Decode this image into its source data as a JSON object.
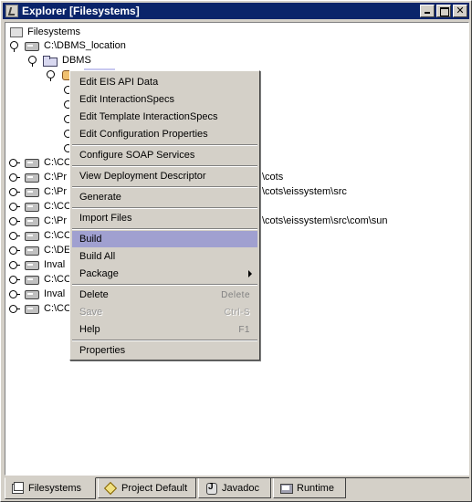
{
  "window": {
    "title": "Explorer [Filesystems]"
  },
  "tree": {
    "root_label": "Filesystems",
    "dbms_location": "C:\\DBMS_location",
    "dbms_folder": "DBMS",
    "fs_rows": [
      {
        "label": "C:\\CO"
      },
      {
        "label": "C:\\Pr",
        "suffix": "\\cots"
      },
      {
        "label": "C:\\Pr",
        "suffix": "\\cots\\eissystem\\src"
      },
      {
        "label": "C:\\CO"
      },
      {
        "label": "C:\\Pr",
        "suffix": "\\cots\\eissystem\\src\\com\\sun"
      },
      {
        "label": "C:\\CO"
      },
      {
        "label": "C:\\DE"
      },
      {
        "label": "Inval"
      },
      {
        "label": "C:\\CO"
      },
      {
        "label": "Inval"
      },
      {
        "label": "C:\\CO"
      }
    ]
  },
  "context_menu": {
    "items": {
      "edit_eis_api": "Edit EIS API Data",
      "edit_interaction_specs": "Edit InteractionSpecs",
      "edit_template_specs": "Edit Template InteractionSpecs",
      "edit_config_props": "Edit Configuration Properties",
      "configure_soap": "Configure SOAP Services",
      "view_deployment": "View Deployment Descriptor",
      "generate": "Generate",
      "import_files": "Import Files",
      "build": "Build",
      "build_all": "Build All",
      "package": "Package",
      "delete": "Delete",
      "delete_shortcut": "Delete",
      "save": "Save",
      "save_shortcut": "Ctrl-S",
      "help": "Help",
      "help_shortcut": "F1",
      "properties": "Properties"
    }
  },
  "tabs": [
    {
      "label": "Filesystems",
      "icon": "filesystems-icon"
    },
    {
      "label": "Project Default",
      "icon": "project-icon"
    },
    {
      "label": "Javadoc",
      "icon": "javadoc-icon"
    },
    {
      "label": "Runtime",
      "icon": "runtime-icon"
    }
  ],
  "colors": {
    "title_bar": "#0a246a",
    "menu_highlight": "#a0a0d0",
    "chrome": "#d4d0c8"
  }
}
